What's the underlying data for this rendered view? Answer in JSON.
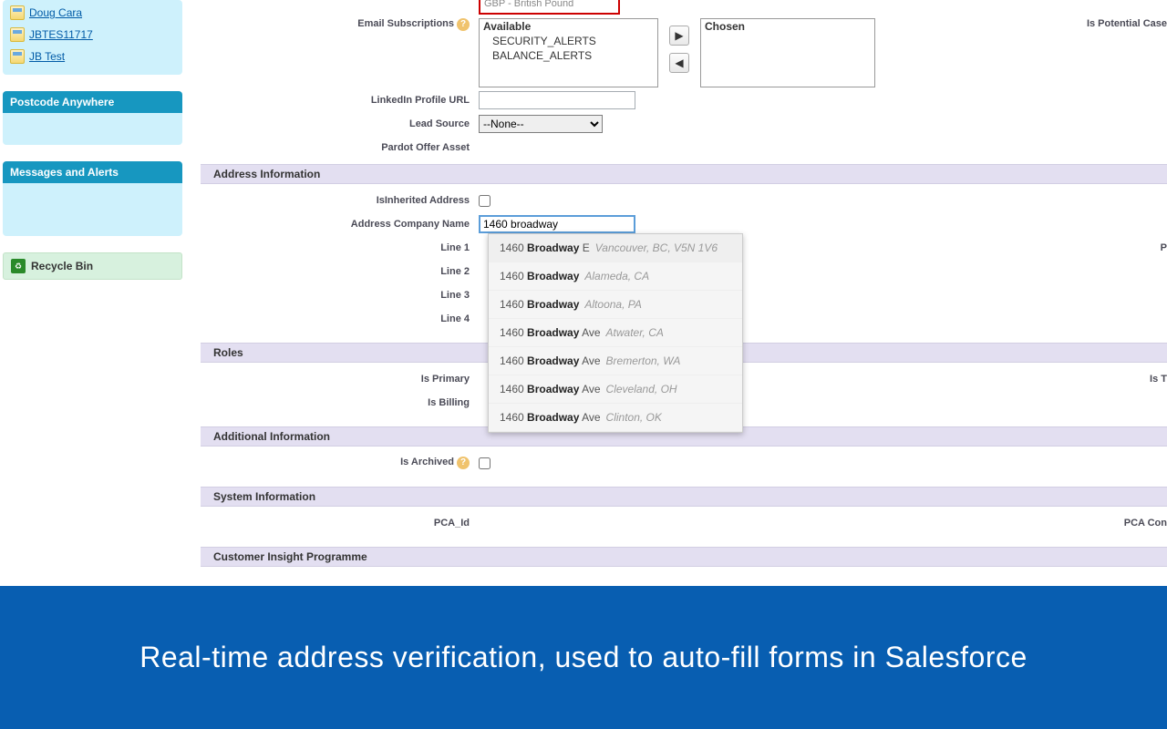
{
  "sidebar": {
    "recent": [
      {
        "label": "Doug Cara"
      },
      {
        "label": "JBTES11717"
      },
      {
        "label": "JB Test"
      }
    ],
    "box1_title": "Postcode Anywhere",
    "box2_title": "Messages and Alerts",
    "recycle": "Recycle Bin"
  },
  "form": {
    "currency_value": "GBP - British Pound",
    "email_sub_label": "Email Subscriptions",
    "avail_header": "Available",
    "avail_opt1": "SECURITY_ALERTS",
    "avail_opt2": "BALANCE_ALERTS",
    "chosen_header": "Chosen",
    "is_potential_label": "Is Potential Case",
    "linkedin_label": "LinkedIn Profile URL",
    "linkedin_value": "",
    "leadsource_label": "Lead Source",
    "leadsource_value": "--None--",
    "pardot_label": "Pardot Offer Asset"
  },
  "addr": {
    "section": "Address Information",
    "inherited_label": "IsInherited Address",
    "company_label": "Address Company Name",
    "company_value": "1460 broadway",
    "line1": "Line 1",
    "line2": "Line 2",
    "line3": "Line 3",
    "line4": "Line 4",
    "right_p": "P"
  },
  "roles": {
    "section": "Roles",
    "primary": "Is Primary",
    "billing": "Is Billing",
    "right_t": "Is T"
  },
  "additional": {
    "section": "Additional Information",
    "archived": "Is Archived"
  },
  "system": {
    "section": "System Information",
    "pca_id": "PCA_Id",
    "pca_con": "PCA Con"
  },
  "customer": {
    "section": "Customer Insight Programme"
  },
  "autocomplete": [
    {
      "p1": "1460 ",
      "b": "Broadway",
      "p2": " E",
      "loc": "Vancouver, BC, V5N 1V6",
      "sel": true
    },
    {
      "p1": "1460 ",
      "b": "Broadway",
      "p2": "",
      "loc": "Alameda, CA"
    },
    {
      "p1": "1460 ",
      "b": "Broadway",
      "p2": "",
      "loc": "Altoona, PA"
    },
    {
      "p1": "1460 ",
      "b": "Broadway",
      "p2": " Ave",
      "loc": "Atwater, CA"
    },
    {
      "p1": "1460 ",
      "b": "Broadway",
      "p2": " Ave",
      "loc": "Bremerton, WA"
    },
    {
      "p1": "1460 ",
      "b": "Broadway",
      "p2": " Ave",
      "loc": "Cleveland, OH"
    },
    {
      "p1": "1460 ",
      "b": "Broadway",
      "p2": " Ave",
      "loc": "Clinton, OK"
    }
  ],
  "banner": "Real-time address verification, used to auto-fill forms in Salesforce"
}
